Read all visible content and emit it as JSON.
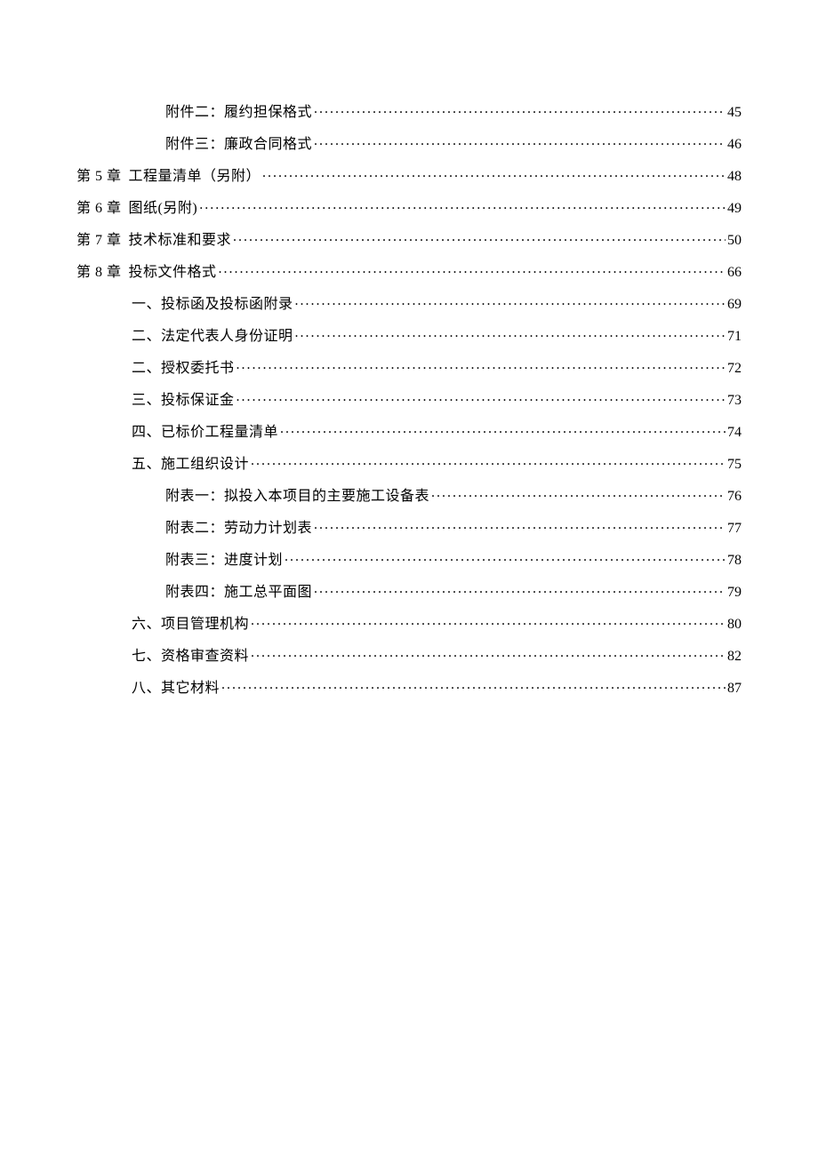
{
  "toc": [
    {
      "level": 2,
      "prefix": "",
      "title": "附件二：履约担保格式",
      "page": "45"
    },
    {
      "level": 2,
      "prefix": "",
      "title": "附件三：廉政合同格式",
      "page": "46"
    },
    {
      "level": 0,
      "prefix": "第 5 章",
      "title": "工程量清单（另附）",
      "page": "48"
    },
    {
      "level": 0,
      "prefix": "第 6 章",
      "title": "图纸(另附)",
      "page": "49"
    },
    {
      "level": 0,
      "prefix": "第 7 章",
      "title": "技术标准和要求",
      "page": "50"
    },
    {
      "level": 0,
      "prefix": "第 8 章",
      "title": "投标文件格式",
      "page": "66"
    },
    {
      "level": 1,
      "prefix": "",
      "title": "一、投标函及投标函附录",
      "page": "69"
    },
    {
      "level": 1,
      "prefix": "",
      "title": "二、法定代表人身份证明",
      "page": "71"
    },
    {
      "level": 1,
      "prefix": "",
      "title": "二、授权委托书",
      "page": "72"
    },
    {
      "level": 1,
      "prefix": "",
      "title": "三、投标保证金",
      "page": "73"
    },
    {
      "level": 1,
      "prefix": "",
      "title": "四、已标价工程量清单",
      "page": "74"
    },
    {
      "level": 1,
      "prefix": "",
      "title": "五、施工组织设计",
      "page": "75"
    },
    {
      "level": 2,
      "prefix": "",
      "title": "附表一：拟投入本项目的主要施工设备表",
      "page": "76"
    },
    {
      "level": 2,
      "prefix": "",
      "title": "附表二：劳动力计划表",
      "page": "77"
    },
    {
      "level": 2,
      "prefix": "",
      "title": "附表三：进度计划",
      "page": "78"
    },
    {
      "level": 2,
      "prefix": "",
      "title": "附表四：施工总平面图",
      "page": "79"
    },
    {
      "level": 1,
      "prefix": "",
      "title": "六、项目管理机构",
      "page": "80"
    },
    {
      "level": 1,
      "prefix": "",
      "title": "七、资格审查资料",
      "page": "82"
    },
    {
      "level": 1,
      "prefix": "",
      "title": "八、其它材料",
      "page": "87"
    }
  ]
}
